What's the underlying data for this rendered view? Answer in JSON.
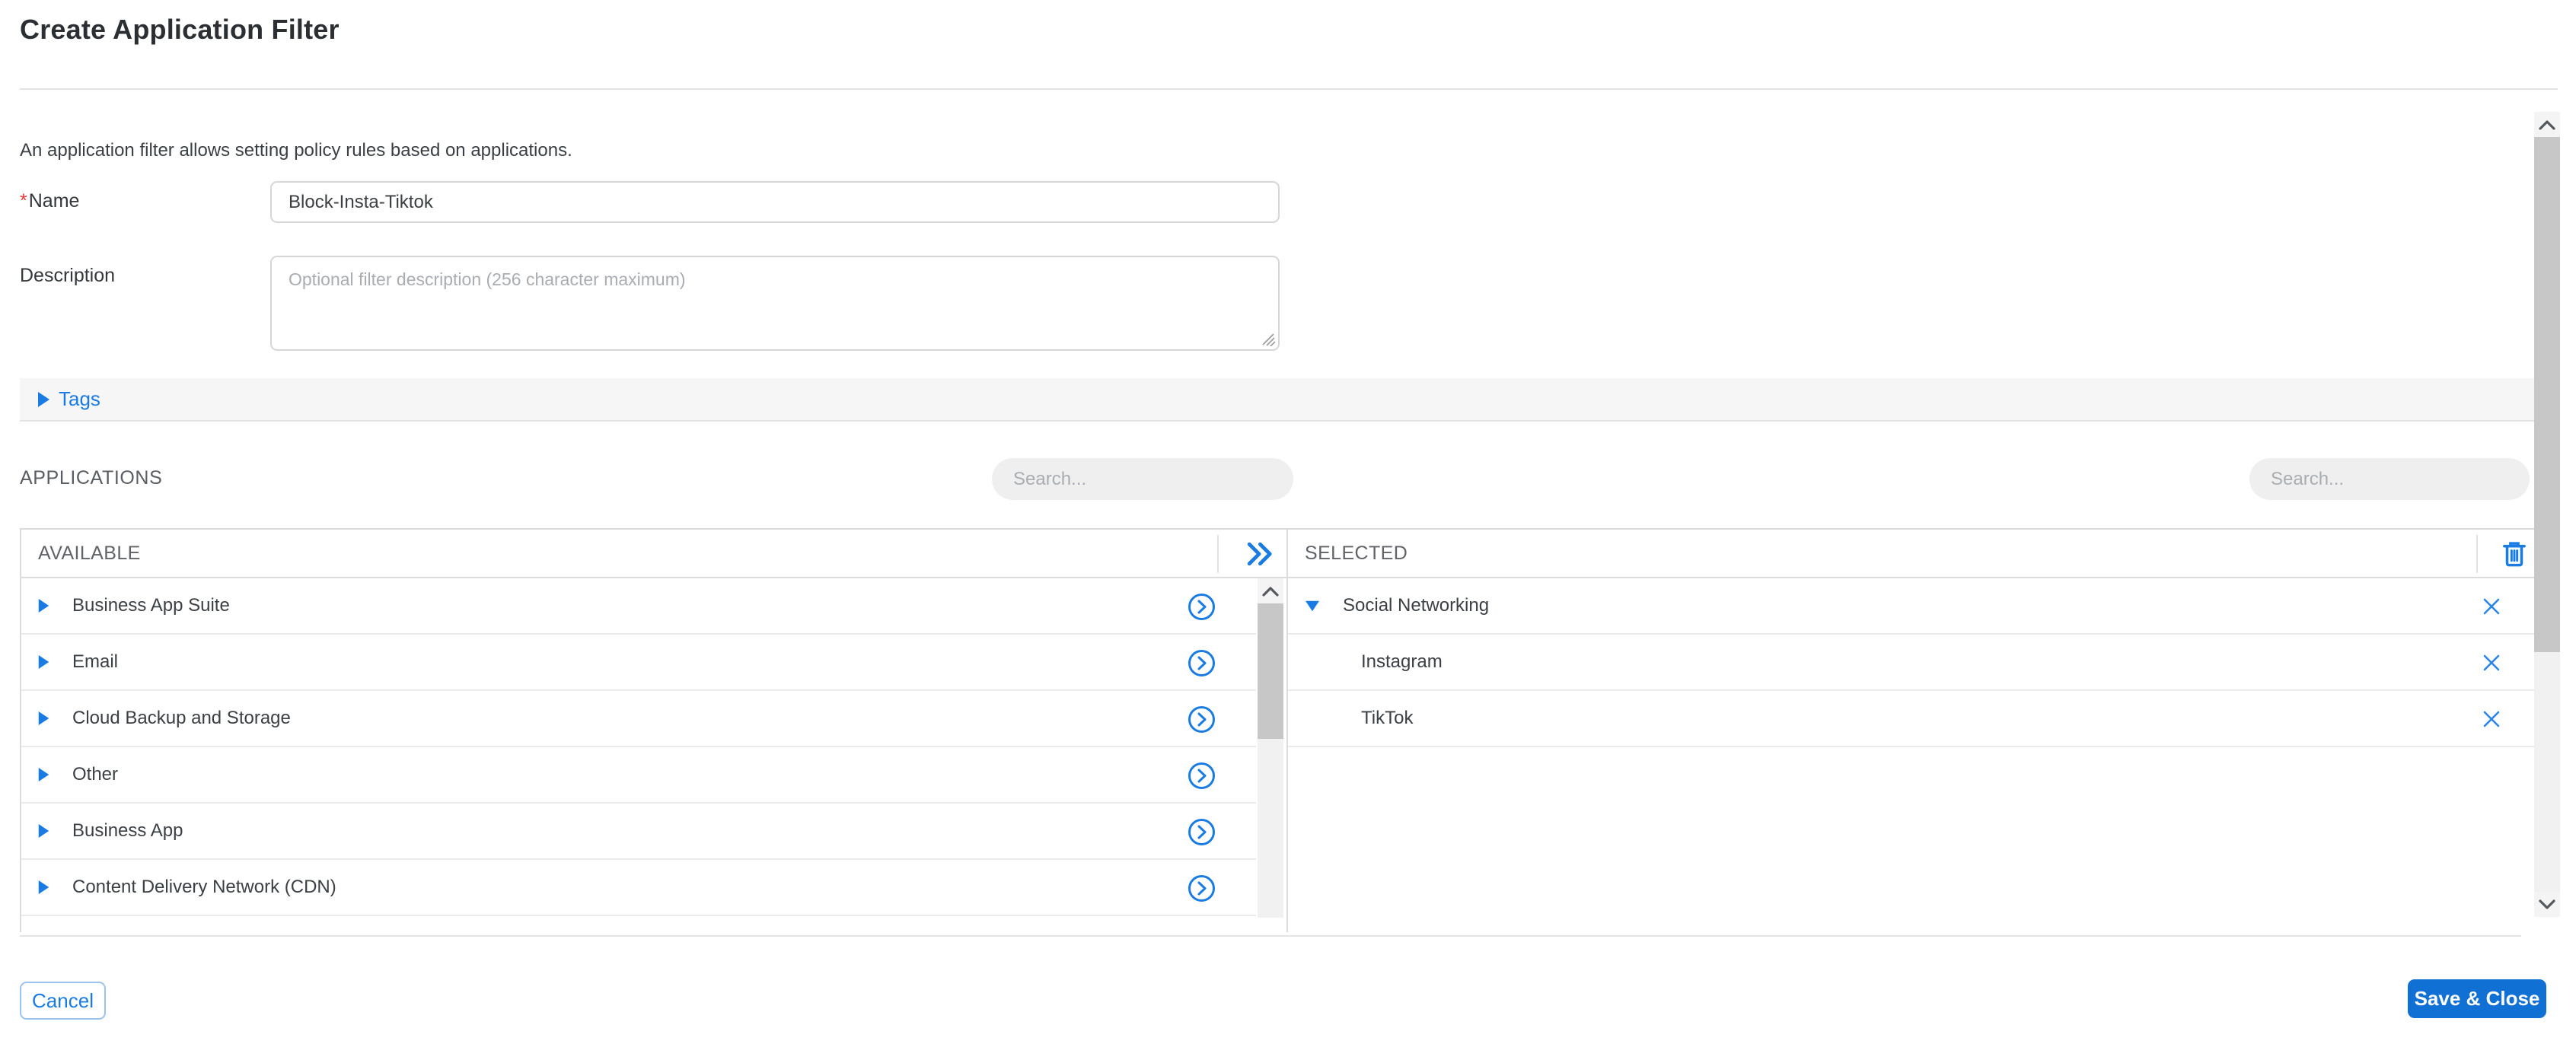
{
  "header": {
    "title": "Create Application Filter"
  },
  "form": {
    "intro": "An application filter allows setting policy rules based on applications.",
    "name": {
      "required_mark": "*",
      "label": "Name",
      "value": "Block-Insta-Tiktok"
    },
    "description": {
      "label": "Description",
      "placeholder": "Optional filter description (256 character maximum)"
    },
    "tags": {
      "label": "Tags"
    }
  },
  "applications": {
    "section_label": "APPLICATIONS",
    "search_available": {
      "placeholder": "Search..."
    },
    "search_selected": {
      "placeholder": "Search..."
    },
    "available": {
      "header": "AVAILABLE",
      "items": [
        "Business App Suite",
        "Email",
        "Cloud Backup and Storage",
        "Other",
        "Business App",
        "Content Delivery Network (CDN)"
      ]
    },
    "selected": {
      "header": "SELECTED",
      "groups": [
        {
          "label": "Social Networking",
          "children": [
            "Instagram",
            "TikTok"
          ]
        }
      ]
    }
  },
  "footer": {
    "cancel_label": "Cancel",
    "save_label": "Save & Close"
  },
  "icons": {
    "tags_caret": "caret-right",
    "available_row_caret": "caret-right",
    "selected_group_caret": "caret-down",
    "move_all": "double-chevron-right",
    "add_item": "chevron-right-circle",
    "clear_all": "trash",
    "remove_item": "x-mark"
  },
  "colors": {
    "accent_blue": "#1a7ce2",
    "primary_button_blue": "#1170d3",
    "required_red": "#e53935",
    "search_pill_gray": "#efefef",
    "band_gray": "#f6f6f7"
  }
}
